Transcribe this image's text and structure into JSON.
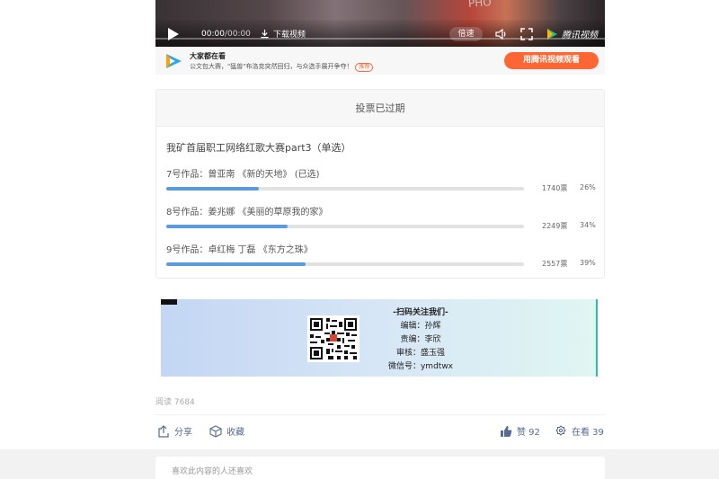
{
  "video": {
    "scene_text": "PHO",
    "current_time": "00:00",
    "total_time": "/00:00",
    "download_label": "下载视频",
    "speed_label": "倍速",
    "brand": "腾讯视频"
  },
  "promo": {
    "title": "大家都在看",
    "subtitle": "公文包大赛，\"猛兽\"布洛克突然回归，与众选手展开争夺！",
    "badge": "推荐",
    "button": "用腾讯视频观看"
  },
  "vote": {
    "status": "投票已过期",
    "question": "我矿首届职工网络红歌大赛part3（单选）",
    "options": [
      {
        "label": "7号作品：曾亚南 《新的天地》 (已选)",
        "count": "1740票",
        "pct": "26%",
        "fraction": 0.26
      },
      {
        "label": "8号作品：姜兆娜 《美丽的草原我的家》",
        "count": "2249票",
        "pct": "34%",
        "fraction": 0.34
      },
      {
        "label": "9号作品：卓红梅 丁磊 《东方之珠》",
        "count": "2557票",
        "pct": "39%",
        "fraction": 0.39
      }
    ]
  },
  "qr": {
    "heading": "-扫码关注我们-",
    "editor": "编辑：孙辉",
    "chief": "责编：李欣",
    "reviewer": "审核：盛玉强",
    "wechat": "微信号：ymdtwx"
  },
  "stats": {
    "reads": "阅读 7684"
  },
  "actions": {
    "share": "分享",
    "favorite": "收藏",
    "like": "赞 92",
    "watching": "在看 39"
  },
  "recommend": {
    "label": "喜欢此内容的人还喜欢"
  },
  "colors": {
    "accent": "#576b95",
    "bar_fill": "#5b9bdc",
    "promo_button": "#ff6633"
  }
}
